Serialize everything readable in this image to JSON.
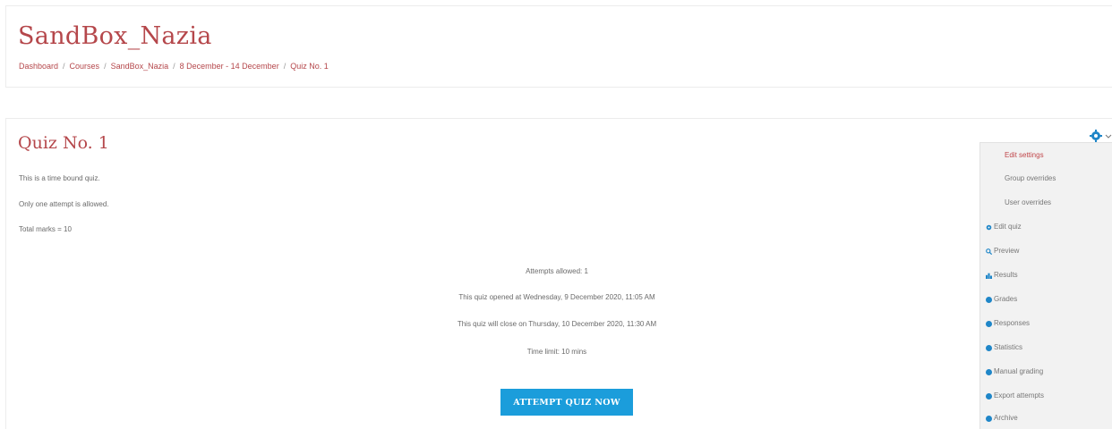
{
  "header": {
    "site_title": "SandBox_Nazia",
    "breadcrumb": [
      "Dashboard",
      "Courses",
      "SandBox_Nazia",
      "8 December - 14 December",
      "Quiz No. 1"
    ],
    "breadcrumb_separator": "/"
  },
  "quiz": {
    "title": "Quiz No. 1",
    "intro": [
      "This is a time bound quiz.",
      "Only one attempt is allowed.",
      "Total marks = 10"
    ],
    "summary": [
      "Attempts allowed: 1",
      "This quiz opened at Wednesday, 9 December 2020, 11:05 AM",
      "This quiz will close on Thursday, 10 December 2020, 11:30 AM",
      "Time limit: 10 mins"
    ],
    "attempt_button": "ATTEMPT QUIZ NOW"
  },
  "admin_menu": {
    "gear_icon": "gear-icon",
    "items": [
      {
        "label": "Edit settings",
        "icon": "none"
      },
      {
        "label": "Group overrides",
        "icon": "none"
      },
      {
        "label": "User overrides",
        "icon": "none"
      },
      {
        "label": "Edit quiz",
        "icon": "gear-icon"
      },
      {
        "label": "Preview",
        "icon": "search-icon"
      },
      {
        "label": "Results",
        "icon": "bar-chart-icon"
      },
      {
        "label": "Grades",
        "icon": "dot-icon"
      },
      {
        "label": "Responses",
        "icon": "dot-icon"
      },
      {
        "label": "Statistics",
        "icon": "dot-icon"
      },
      {
        "label": "Manual grading",
        "icon": "dot-icon"
      },
      {
        "label": "Export attempts",
        "icon": "dot-icon"
      },
      {
        "label": "Archive",
        "icon": "dot-icon"
      }
    ]
  },
  "colors": {
    "accent": "#b5474b",
    "button": "#1b9ddb",
    "menu_icon": "#1f86c8"
  }
}
